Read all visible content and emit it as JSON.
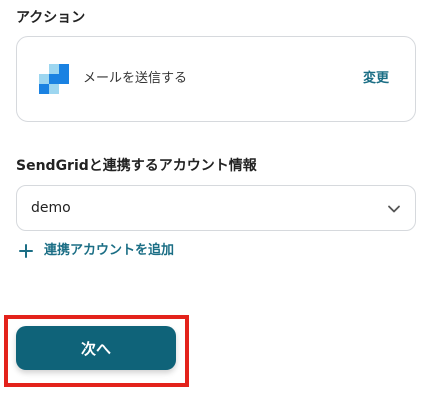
{
  "action_section": {
    "label": "アクション",
    "action_name": "メールを送信する",
    "change_label": "変更",
    "app_icon": "sendgrid-logo-icon"
  },
  "account_section": {
    "label": "SendGridと連携するアカウント情報",
    "selected_account": "demo",
    "add_account_label": "連携アカウントを追加"
  },
  "footer": {
    "next_label": "次へ"
  },
  "colors": {
    "accent": "#1b6e85",
    "button": "#0f6379",
    "highlight": "#e3221b",
    "border": "#d6d9dd"
  }
}
